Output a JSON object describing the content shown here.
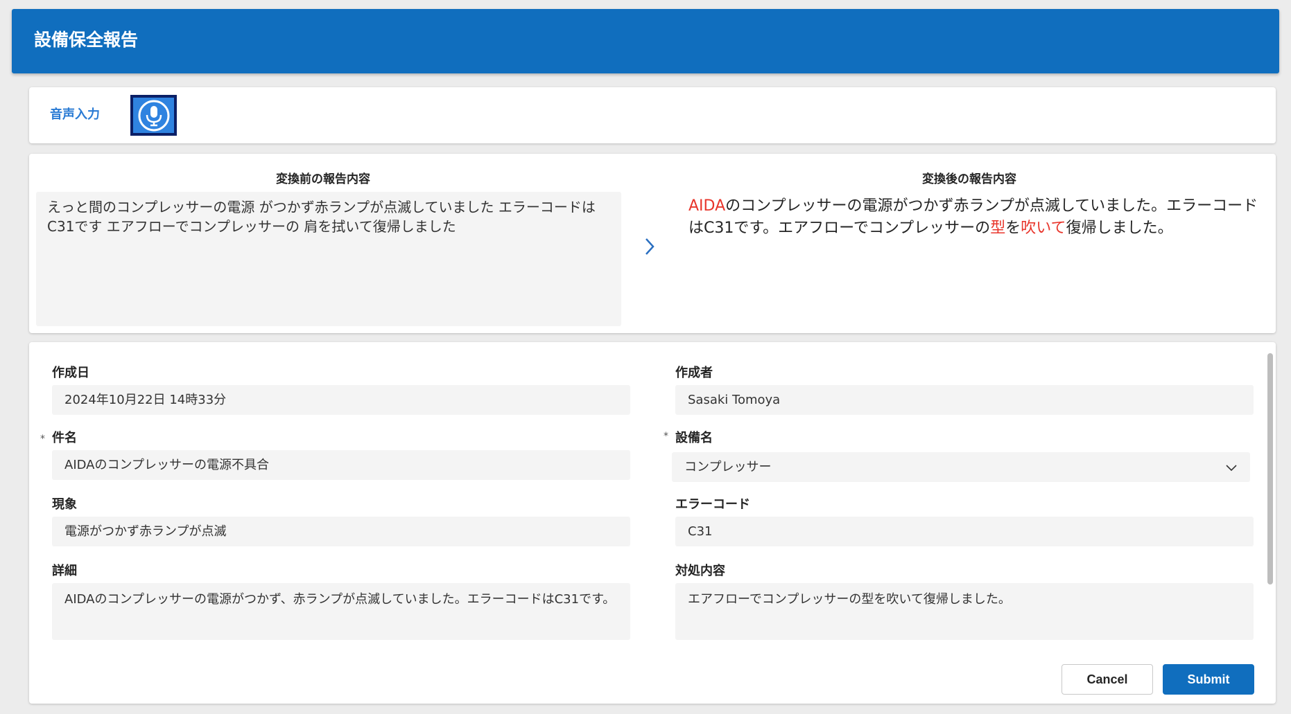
{
  "header": {
    "title": "設備保全報告"
  },
  "voice": {
    "label": "音声入力",
    "icon": "microphone-icon"
  },
  "compare": {
    "before_title": "変換前の報告内容",
    "before_text": "えっと間のコンプレッサーの電源 がつかず赤ランプが点滅していました エラーコードはC31です エアフローでコンプレッサーの 肩を拭いて復帰しました",
    "after_title": "変換後の報告内容",
    "after_segments": [
      {
        "text": "AIDA",
        "changed": true
      },
      {
        "text": "のコンプレッサーの電源がつかず赤ランプが点滅していました。エラーコードはC31です。エアフローでコンプレッサーの",
        "changed": false
      },
      {
        "text": "型",
        "changed": true
      },
      {
        "text": "を",
        "changed": false
      },
      {
        "text": "吹いて",
        "changed": true
      },
      {
        "text": "復帰しました。",
        "changed": false
      }
    ],
    "highlight_color": "#e8352b"
  },
  "form": {
    "created_date": {
      "label": "作成日",
      "value": "2024年10月22日 14時33分"
    },
    "author": {
      "label": "作成者",
      "value": "Sasaki Tomoya"
    },
    "subject": {
      "label": "件名",
      "required_mark": "*",
      "value": "AIDAのコンプレッサーの電源不具合"
    },
    "equipment": {
      "label": "設備名",
      "required_mark": "*",
      "value": "コンプレッサー"
    },
    "symptom": {
      "label": "現象",
      "value": "電源がつかず赤ランプが点滅"
    },
    "error_code": {
      "label": "エラーコード",
      "value": "C31"
    },
    "detail": {
      "label": "詳細",
      "value": "AIDAのコンプレッサーの電源がつかず、赤ランプが点滅していました。エラーコードはC31です。"
    },
    "action": {
      "label": "対処内容",
      "value": "エアフローでコンプレッサーの型を吹いて復帰しました。"
    }
  },
  "buttons": {
    "cancel": "Cancel",
    "submit": "Submit"
  },
  "colors": {
    "accent": "#106ebe",
    "highlight": "#e8352b"
  }
}
